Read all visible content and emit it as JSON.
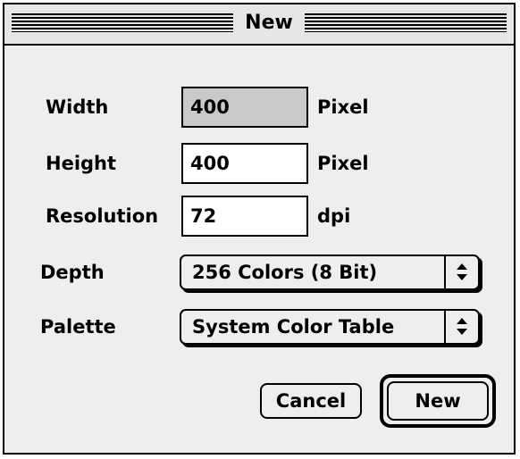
{
  "dialog": {
    "title": "New"
  },
  "fields": {
    "width": {
      "label": "Width",
      "value": "400",
      "unit": "Pixel"
    },
    "height": {
      "label": "Height",
      "value": "400",
      "unit": "Pixel"
    },
    "resolution": {
      "label": "Resolution",
      "value": "72",
      "unit": "dpi"
    }
  },
  "depth": {
    "label": "Depth",
    "selected": "256 Colors (8 Bit)"
  },
  "palette": {
    "label": "Palette",
    "selected": "System Color Table"
  },
  "buttons": {
    "cancel": "Cancel",
    "new": "New"
  }
}
